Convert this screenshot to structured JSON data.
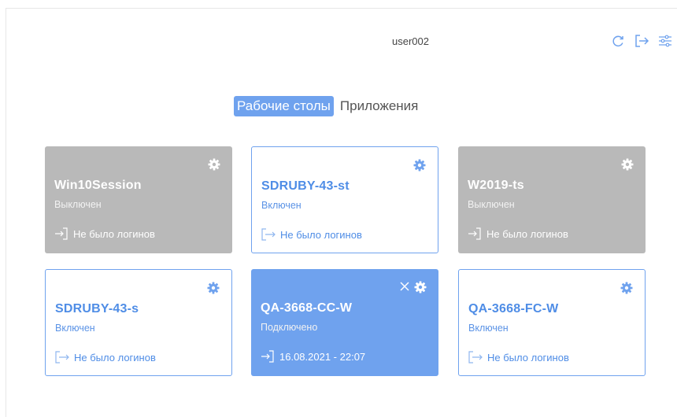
{
  "header": {
    "username": "user002",
    "icons": [
      "refresh-icon",
      "logout-icon",
      "settings-sliders-icon"
    ]
  },
  "tabs": [
    {
      "label": "Рабочие столы",
      "active": true
    },
    {
      "label": "Приложения",
      "active": false
    }
  ],
  "cards": [
    {
      "name": "Win10Session",
      "status": "Выключен",
      "login": "Не было логинов",
      "state": "off"
    },
    {
      "name": "SDRUBY-43-st",
      "status": "Включен",
      "login": "Не было логинов",
      "state": "on"
    },
    {
      "name": "W2019-ts",
      "status": "Выключен",
      "login": "Не было логинов",
      "state": "off"
    },
    {
      "name": "SDRUBY-43-s",
      "status": "Включен",
      "login": "Не было логинов",
      "state": "on"
    },
    {
      "name": "QA-3668-CC-W",
      "status": "Подключено",
      "login": "16.08.2021 - 22:07",
      "state": "connected"
    },
    {
      "name": "QA-3668-FC-W",
      "status": "Включен",
      "login": "Не было логинов",
      "state": "on"
    }
  ],
  "colors": {
    "accent": "#6fa2ee",
    "off_card": "#b9b9b9",
    "text_blue": "#4f8de6"
  }
}
